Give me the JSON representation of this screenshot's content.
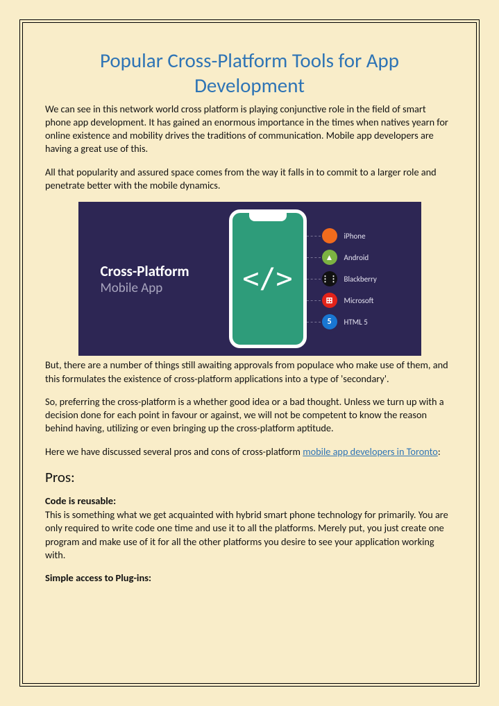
{
  "title": "Popular Cross-Platform Tools for App Development",
  "para1": "We can see in this network world cross platform is playing conjunctive role in the field of smart phone app development. It has gained an enormous importance in the times when natives yearn for online existence and mobility drives the traditions of communication. Mobile app developers are having a great use of this.",
  "para2": "All that popularity and assured space comes from the way it falls in to commit to a larger role and penetrate better with the mobile dynamics.",
  "figure": {
    "heading": "Cross-Platform",
    "sub": "Mobile App",
    "glyph": "</>",
    "platforms": [
      {
        "label": "iPhone",
        "color": "#f26b1d",
        "icon": ""
      },
      {
        "label": "Android",
        "color": "#7cb342",
        "icon": "▲"
      },
      {
        "label": "Blackberry",
        "color": "#111111",
        "icon": "⋮⋮"
      },
      {
        "label": "Microsoft",
        "color": "#e2231a",
        "icon": "⊞"
      },
      {
        "label": "HTML 5",
        "color": "#1976d2",
        "icon": "5"
      }
    ]
  },
  "para3": "But, there are a number of things still awaiting approvals from populace who make use of them, and this formulates the existence of cross-platform applications into a type of 'secondary'.",
  "para4": "So, preferring the cross-platform is a whether good idea or a bad thought. Unless we turn up with a decision done for each point in favour or against, we will not be competent to know the reason behind having, utilizing or even bringing up the cross-platform aptitude.",
  "para5_pre": "Here we have discussed several pros and cons of cross-platform ",
  "para5_link": "mobile app developers in Toronto",
  "para5_post": ":",
  "pros_heading": "Pros:",
  "reusable_h": "Code is reusable:",
  "reusable_body": "This is something what we get acquainted with hybrid smart phone technology for primarily. You are only required to write code one time and use it to all the platforms. Merely put, you just create one program and make use of it for all the other platforms you desire to see your application working with.",
  "plugins_h": "Simple access to Plug-ins:"
}
